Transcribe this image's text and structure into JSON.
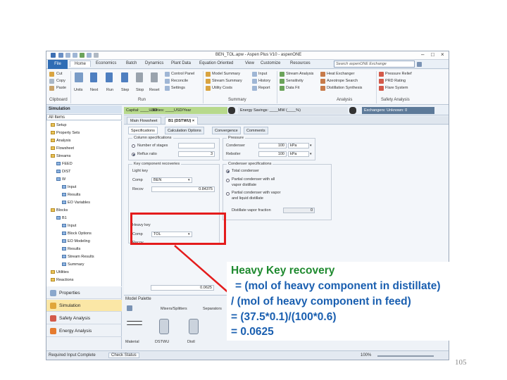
{
  "window": {
    "title": "BEN_TOL.apw - Aspen Plus V10 - aspenONE",
    "tabs": [
      "File",
      "Home",
      "Economics",
      "Batch",
      "Dynamics",
      "Plant Data",
      "Equation Oriented",
      "View",
      "Customize",
      "Resources"
    ],
    "search_placeholder": "Search aspenONE Exchange"
  },
  "ribbon": {
    "clipboard": [
      "Cut",
      "Copy",
      "Paste"
    ],
    "clipboard_group": "Clipboard",
    "units": "Units",
    "run": [
      "Next",
      "Run",
      "Step",
      "Stop",
      "Reset"
    ],
    "run_group": "Run",
    "run_small": [
      "Control Panel",
      "Reconcile",
      "Settings"
    ],
    "summary": [
      "Model Summary",
      "Stream Summary",
      "Utility Costs",
      "Input",
      "History",
      "Report"
    ],
    "summary_group": "Summary",
    "analysis": [
      "Stream Analysis",
      "Sensitivity",
      "Data Fit",
      "Heat Exchanger",
      "Azeotrope Search",
      "Distillation Synthesis"
    ],
    "analysis_group": "Analysis",
    "safety": [
      "Pressure Relief",
      "PRD Rating",
      "Flare System"
    ],
    "safety_group": "Safety Analysis"
  },
  "sidebar": {
    "header": "Simulation",
    "filter": "All Items",
    "tree": [
      {
        "label": "Setup",
        "indent": 0,
        "blue": false
      },
      {
        "label": "Property Sets",
        "indent": 0,
        "blue": false
      },
      {
        "label": "Analysis",
        "indent": 0,
        "blue": false
      },
      {
        "label": "Flowsheet",
        "indent": 0,
        "blue": false
      },
      {
        "label": "Streams",
        "indent": 0,
        "blue": false
      },
      {
        "label": "FEED",
        "indent": 1,
        "blue": true
      },
      {
        "label": "DIST",
        "indent": 1,
        "blue": true
      },
      {
        "label": "W",
        "indent": 1,
        "blue": true
      },
      {
        "label": "Input",
        "indent": 2,
        "blue": true
      },
      {
        "label": "Results",
        "indent": 2,
        "blue": true
      },
      {
        "label": "EO Variables",
        "indent": 2,
        "blue": true
      },
      {
        "label": "Blocks",
        "indent": 0,
        "blue": false
      },
      {
        "label": "B1",
        "indent": 1,
        "blue": true
      },
      {
        "label": "Input",
        "indent": 2,
        "blue": true
      },
      {
        "label": "Block Options",
        "indent": 2,
        "blue": true
      },
      {
        "label": "EO Modeling",
        "indent": 2,
        "blue": true
      },
      {
        "label": "Results",
        "indent": 2,
        "blue": true
      },
      {
        "label": "Stream Results",
        "indent": 2,
        "blue": true
      },
      {
        "label": "Summary",
        "indent": 2,
        "blue": true
      },
      {
        "label": "Utilities",
        "indent": 0,
        "blue": false
      },
      {
        "label": "Reactions",
        "indent": 0,
        "blue": false
      }
    ],
    "nav": [
      "Properties",
      "Simulation",
      "Safety Analysis",
      "Energy Analysis"
    ]
  },
  "costbar": {
    "capital": "Capital: ____USD",
    "utilities": "Utilities: ____USD/Year",
    "energy": "Energy Savings: ____MW  (____%)",
    "exchangers": "Exchangers:   Unknown: 0"
  },
  "doc_tabs": [
    "Main Flowsheet",
    "B1 (DSTWU) ×"
  ],
  "form": {
    "subtabs": [
      "Specifications",
      "Calculation Options",
      "Convergence",
      "Comments"
    ],
    "column_specs": {
      "legend": "Column specifications",
      "stages_label": "Number of stages",
      "stages_value": "",
      "reflux_label": "Reflux ratio",
      "reflux_value": "3"
    },
    "pressure": {
      "legend": "Pressure",
      "condenser_label": "Condenser",
      "condenser_value": "100",
      "condenser_unit": "kPa",
      "reboiler_label": "Reboiler",
      "reboiler_value": "100",
      "reboiler_unit": "kPa"
    },
    "key_recoveries": {
      "legend": "Key component recoveries",
      "light_key": "Light key",
      "comp_label": "Comp",
      "light_comp": "BEN",
      "recov_label": "Recov",
      "light_recov": "0.84375",
      "heavy_key": "Heavy key",
      "heavy_comp": "TOL",
      "heavy_recov": "0.0625"
    },
    "condenser_specs": {
      "legend": "Condenser specifications",
      "opt1": "Total condenser",
      "opt2a": "Partial condenser with all",
      "opt2b": "vapor distillate",
      "opt3a": "Partial condenser with vapor",
      "opt3b": "and liquid distillate",
      "distillate_label": "Distillate vapor fraction",
      "distillate_value": "0"
    }
  },
  "palette": {
    "title": "Model Palette",
    "tabs": [
      "Mixers/Splitters",
      "Separators"
    ],
    "blocks": [
      "Material",
      "DSTWU",
      "Distl"
    ]
  },
  "status": {
    "left": "Required Input Complete",
    "check": "Check Status",
    "zoom": "100%"
  },
  "callout": {
    "line1": "Heavy Key recovery",
    "line2": "= (mol of heavy component in distillate)",
    "line3": "/ (mol of heavy component in feed)",
    "line4": "= (37.5*0.1)/(100*0.6)",
    "line5": "= 0.0625"
  },
  "page_number": "105",
  "colors": {
    "file_tab": "#2f6db5",
    "highlight_box": "#e41c1c",
    "callout_green": "#1f8a2f",
    "callout_blue": "#1a5fb0"
  }
}
